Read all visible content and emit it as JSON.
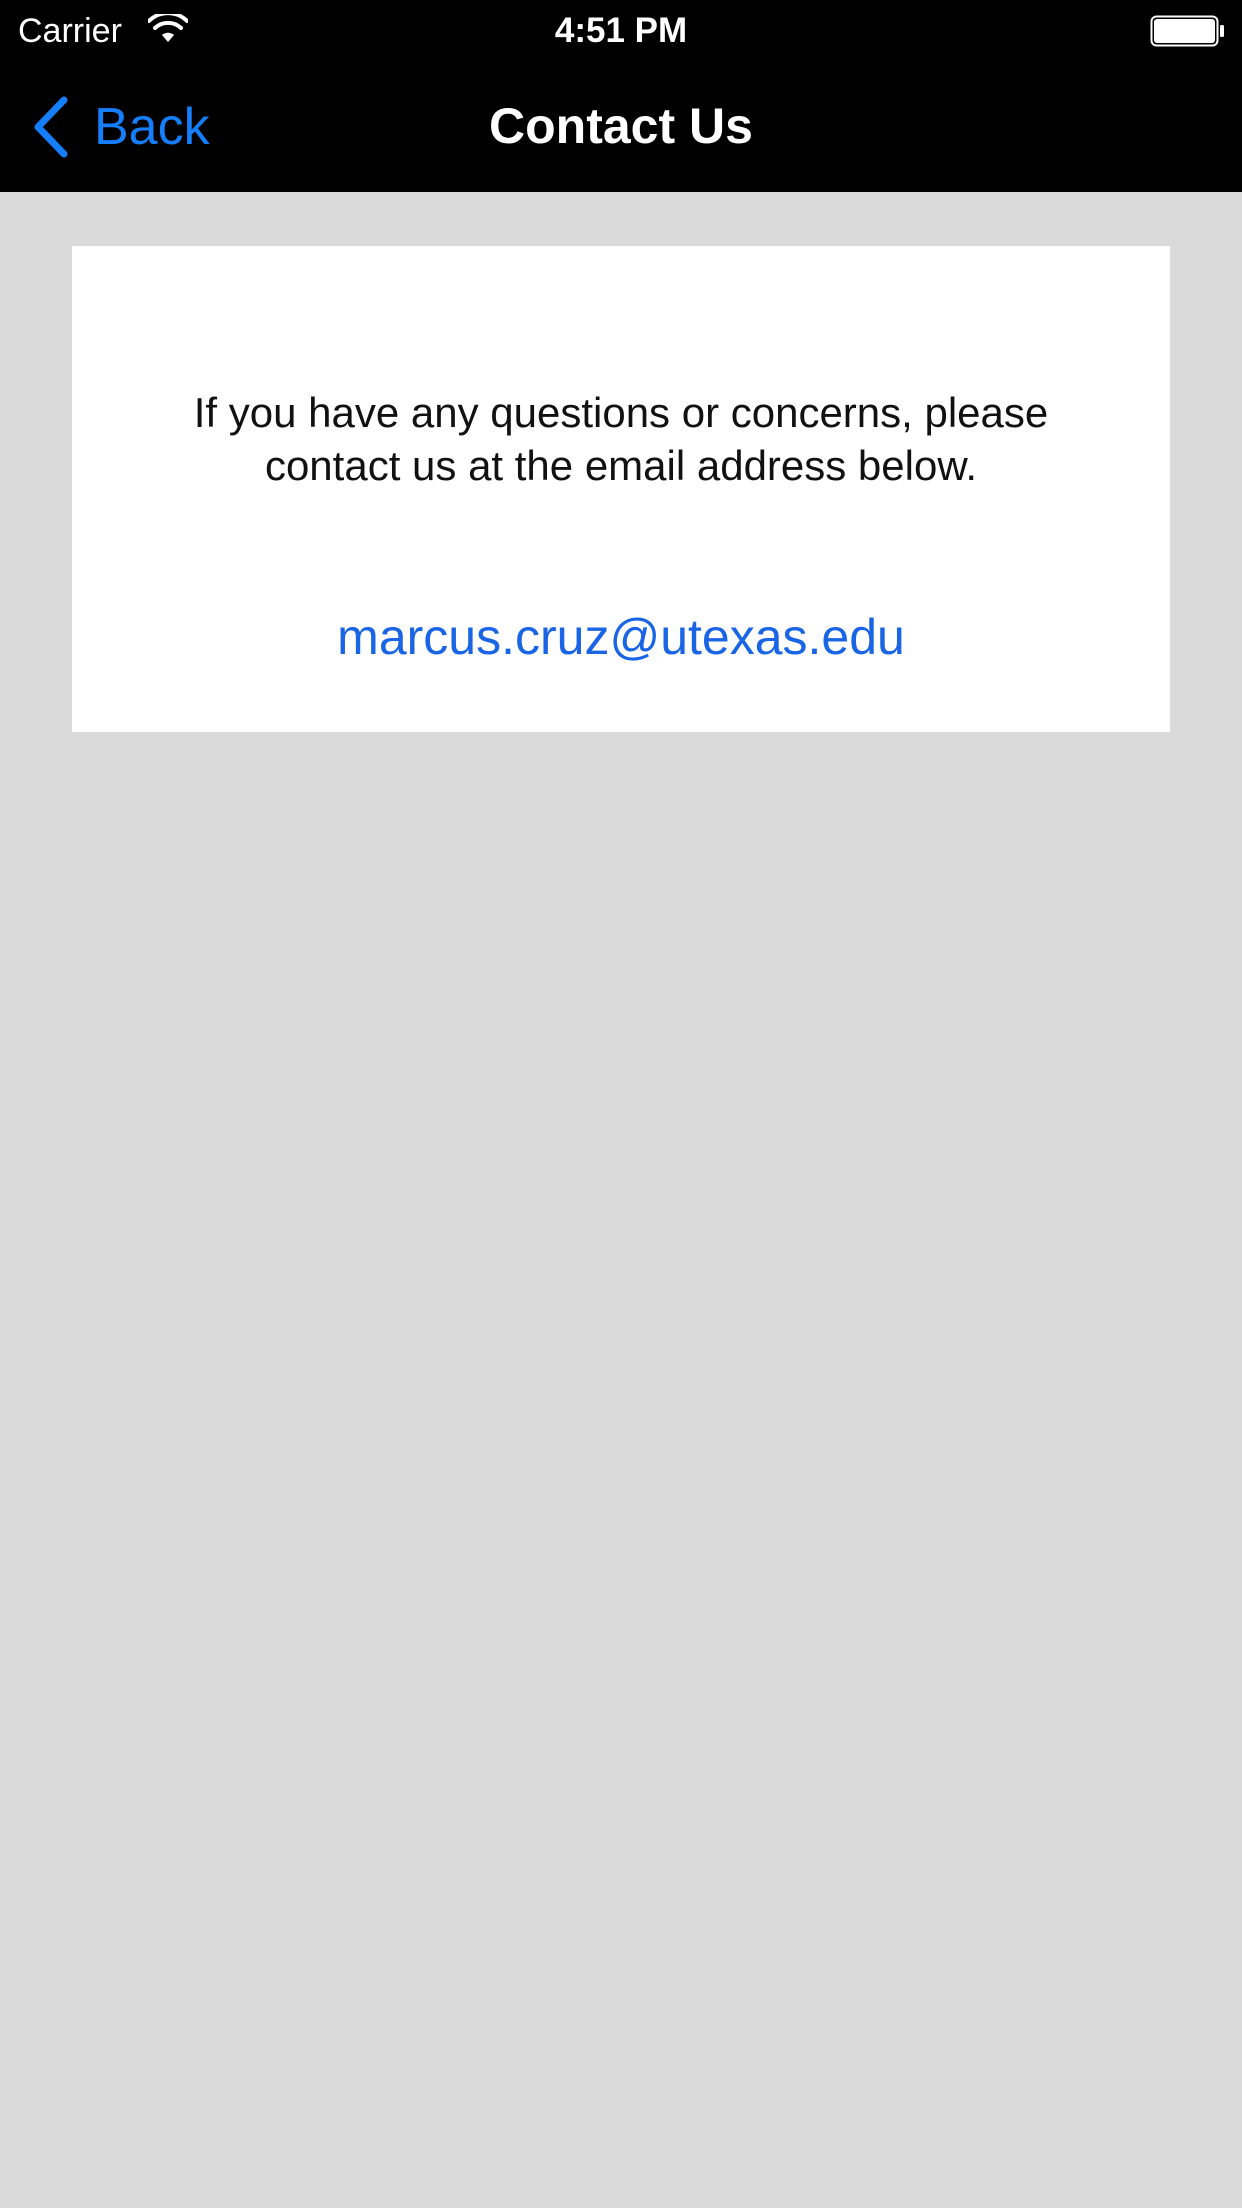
{
  "status_bar": {
    "carrier": "Carrier",
    "time": "4:51 PM",
    "icons": [
      "wifi-icon",
      "battery-icon"
    ]
  },
  "nav_bar": {
    "back_label": "Back",
    "title": "Contact Us",
    "back_icon": "chevron-left-icon"
  },
  "content": {
    "message": "If you have any questions or concerns, please contact us at the email address below.",
    "email": "marcus.cruz@utexas.edu"
  },
  "colors": {
    "accent": "#157efb",
    "link": "#1a64e6",
    "background": "#dadada",
    "bar": "#000000",
    "card": "#ffffff"
  }
}
